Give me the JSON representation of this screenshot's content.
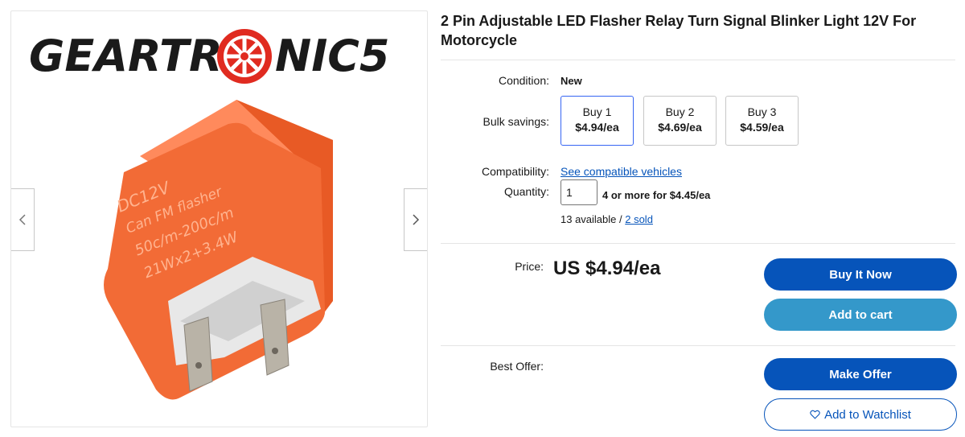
{
  "brand": {
    "logo_text_left": "GEARTR",
    "logo_text_right": "NIC5",
    "logo_color": "#1a1a1a",
    "logo_accent": "#e02b20"
  },
  "product_image": {
    "text_lines": [
      "DC12V",
      "Can FM flasher",
      "50c/m-200c/m",
      "21Wx2+3.4W"
    ],
    "body_color": "#f26b36"
  },
  "listing": {
    "title": "2 Pin Adjustable LED Flasher Relay Turn Signal Blinker Light 12V For Motorcycle"
  },
  "condition": {
    "label": "Condition:",
    "value": "New"
  },
  "bulk": {
    "label": "Bulk savings:",
    "options": [
      {
        "qty": "Buy 1",
        "price": "$4.94/ea",
        "selected": true
      },
      {
        "qty": "Buy 2",
        "price": "$4.69/ea",
        "selected": false
      },
      {
        "qty": "Buy 3",
        "price": "$4.59/ea",
        "selected": false
      }
    ]
  },
  "compatibility": {
    "label": "Compatibility:",
    "link": "See compatible vehicles"
  },
  "quantity": {
    "label": "Quantity:",
    "value": "1",
    "discount": "4 or more for $4.45/ea",
    "available": "13 available / ",
    "sold": "2 sold"
  },
  "price": {
    "label": "Price:",
    "value": "US $4.94/ea"
  },
  "best_offer": {
    "label": "Best Offer:"
  },
  "actions": {
    "buy_now": "Buy It Now",
    "add_to_cart": "Add to cart",
    "make_offer": "Make Offer",
    "watchlist": "Add to Watchlist"
  },
  "colors": {
    "primary": "#0654ba",
    "secondary": "#3498ca",
    "link": "#0654ba",
    "selected_border": "#3665f3"
  }
}
